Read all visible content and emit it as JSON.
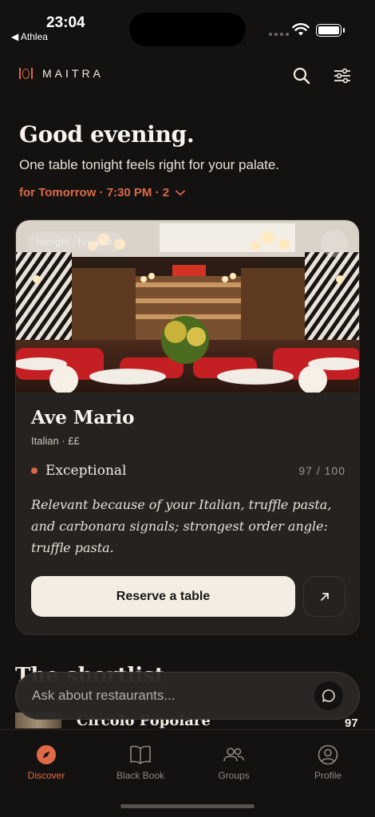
{
  "status_bar": {
    "time": "23:04",
    "back_app": "◀ Athlea"
  },
  "header": {
    "brand": "MAITRA"
  },
  "greeting": {
    "title": "Good evening.",
    "subtitle": "One table tonight feels right for your palate.",
    "when": "for Tomorrow · 7:30 PM · 2"
  },
  "card": {
    "chip": "tonight, for you",
    "name": "Ave Mario",
    "meta": "Italian · ££",
    "rating_label": "Exceptional",
    "score": "97 / 100",
    "reason": "Relevant because of your Italian, truffle pasta, and carbonara signals; strongest order angle: truffle pasta.",
    "reserve_label": "Reserve a table"
  },
  "list_section": {
    "title": "The shortlist",
    "first_item": {
      "name": "Circolo Popolare",
      "score": "97"
    }
  },
  "ask_bar": {
    "placeholder": "Ask about restaurants..."
  },
  "tabs": [
    {
      "label": "Discover",
      "icon": "compass-icon",
      "active": true
    },
    {
      "label": "Black Book",
      "icon": "book-icon",
      "active": false
    },
    {
      "label": "Groups",
      "icon": "users-icon",
      "active": false
    },
    {
      "label": "Profile",
      "icon": "profile-icon",
      "active": false
    }
  ],
  "colors": {
    "accent": "#d9684a",
    "background": "#141210",
    "card": "#25221f",
    "button": "#f3ede4"
  }
}
